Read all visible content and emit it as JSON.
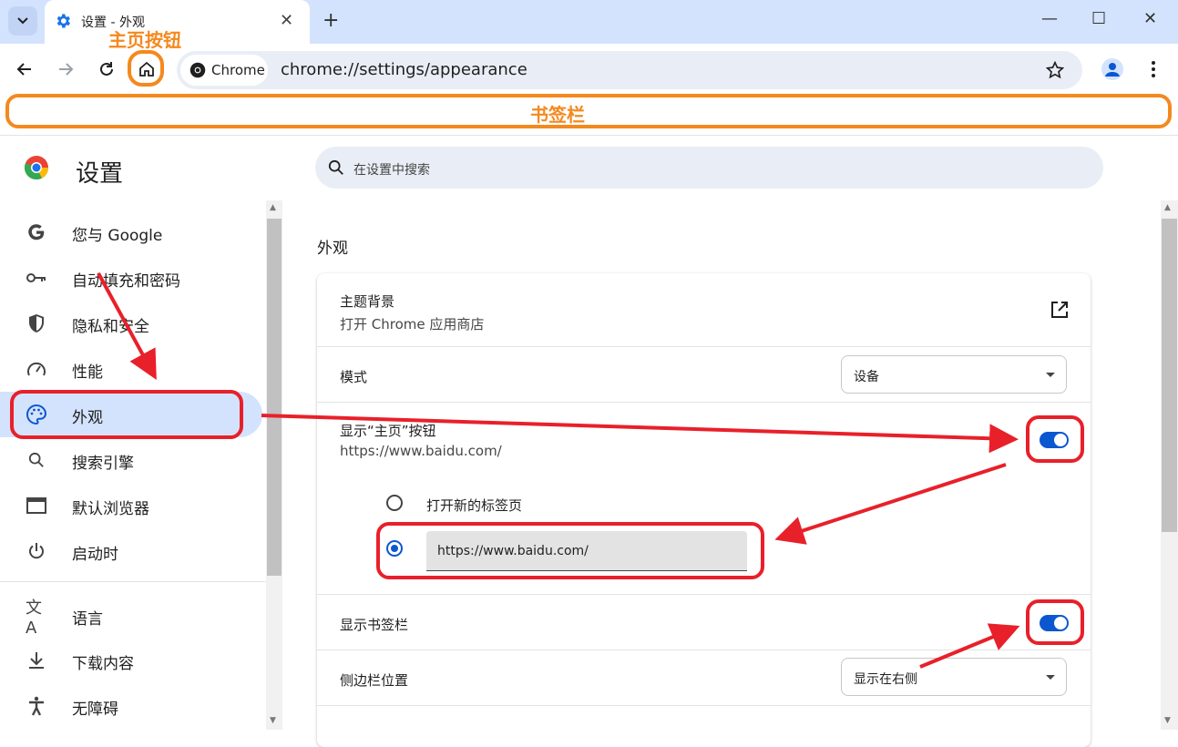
{
  "tab": {
    "title": "设置 - 外观"
  },
  "omnibox": {
    "chip_label": "Chrome",
    "url": "chrome://settings/appearance"
  },
  "annotations": {
    "home_button": "主页按钮",
    "bookmarks_bar": "书签栏"
  },
  "settings": {
    "title": "设置",
    "search_placeholder": "在设置中搜索"
  },
  "sidebar": {
    "items": [
      {
        "label": "您与 Google",
        "icon": "google-icon"
      },
      {
        "label": "自动填充和密码",
        "icon": "key-icon"
      },
      {
        "label": "隐私和安全",
        "icon": "shield-icon"
      },
      {
        "label": "性能",
        "icon": "speedometer-icon"
      },
      {
        "label": "外观",
        "icon": "palette-icon",
        "active": true
      },
      {
        "label": "搜索引擎",
        "icon": "search-icon"
      },
      {
        "label": "默认浏览器",
        "icon": "browser-window-icon"
      },
      {
        "label": "启动时",
        "icon": "power-icon"
      },
      {
        "label": "语言",
        "icon": "translate-icon"
      },
      {
        "label": "下载内容",
        "icon": "download-icon"
      },
      {
        "label": "无障碍",
        "icon": "accessibility-icon"
      }
    ]
  },
  "appearance": {
    "section_title": "外观",
    "theme": {
      "label": "主题背景",
      "sub": "打开 Chrome 应用商店"
    },
    "mode": {
      "label": "模式",
      "value": "设备"
    },
    "home_button": {
      "label": "显示“主页”按钮",
      "sub": "https://www.baidu.com/",
      "enabled": true,
      "option_new_tab": "打开新的标签页",
      "custom_url": "https://www.baidu.com/"
    },
    "bookmarks_bar": {
      "label": "显示书签栏",
      "enabled": true
    },
    "side_panel": {
      "label": "侧边栏位置",
      "value": "显示在右侧"
    }
  },
  "colors": {
    "accent": "#0b57d0",
    "annotation_orange": "#f4891e",
    "annotation_red": "#e8202a"
  }
}
